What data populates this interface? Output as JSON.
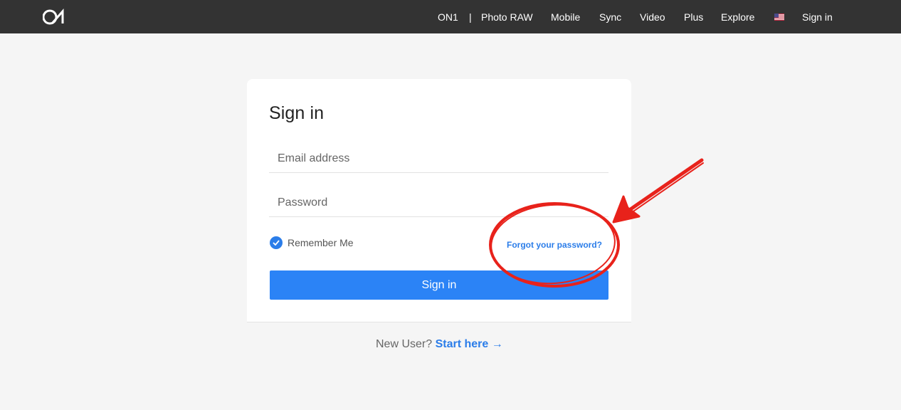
{
  "header": {
    "logo_alt": "ON1",
    "nav": {
      "on1": "ON1",
      "separator": "|",
      "photo_raw": "Photo RAW",
      "mobile": "Mobile",
      "sync": "Sync",
      "video": "Video",
      "plus": "Plus",
      "explore": "Explore",
      "flag_icon": "us-flag-icon",
      "sign_in": "Sign in"
    }
  },
  "form": {
    "title": "Sign in",
    "email": {
      "placeholder": "Email address",
      "value": ""
    },
    "password": {
      "placeholder": "Password",
      "value": ""
    },
    "remember_label": "Remember Me",
    "remember_checked": true,
    "forgot_label": "Forgot your password?",
    "submit_label": "Sign in"
  },
  "footer": {
    "new_user_text": "New User?",
    "start_link": "Start here →"
  },
  "colors": {
    "accent": "#2b83f6",
    "link": "#2b7de9",
    "topbar": "#333333",
    "annotation": "#e8221b"
  }
}
